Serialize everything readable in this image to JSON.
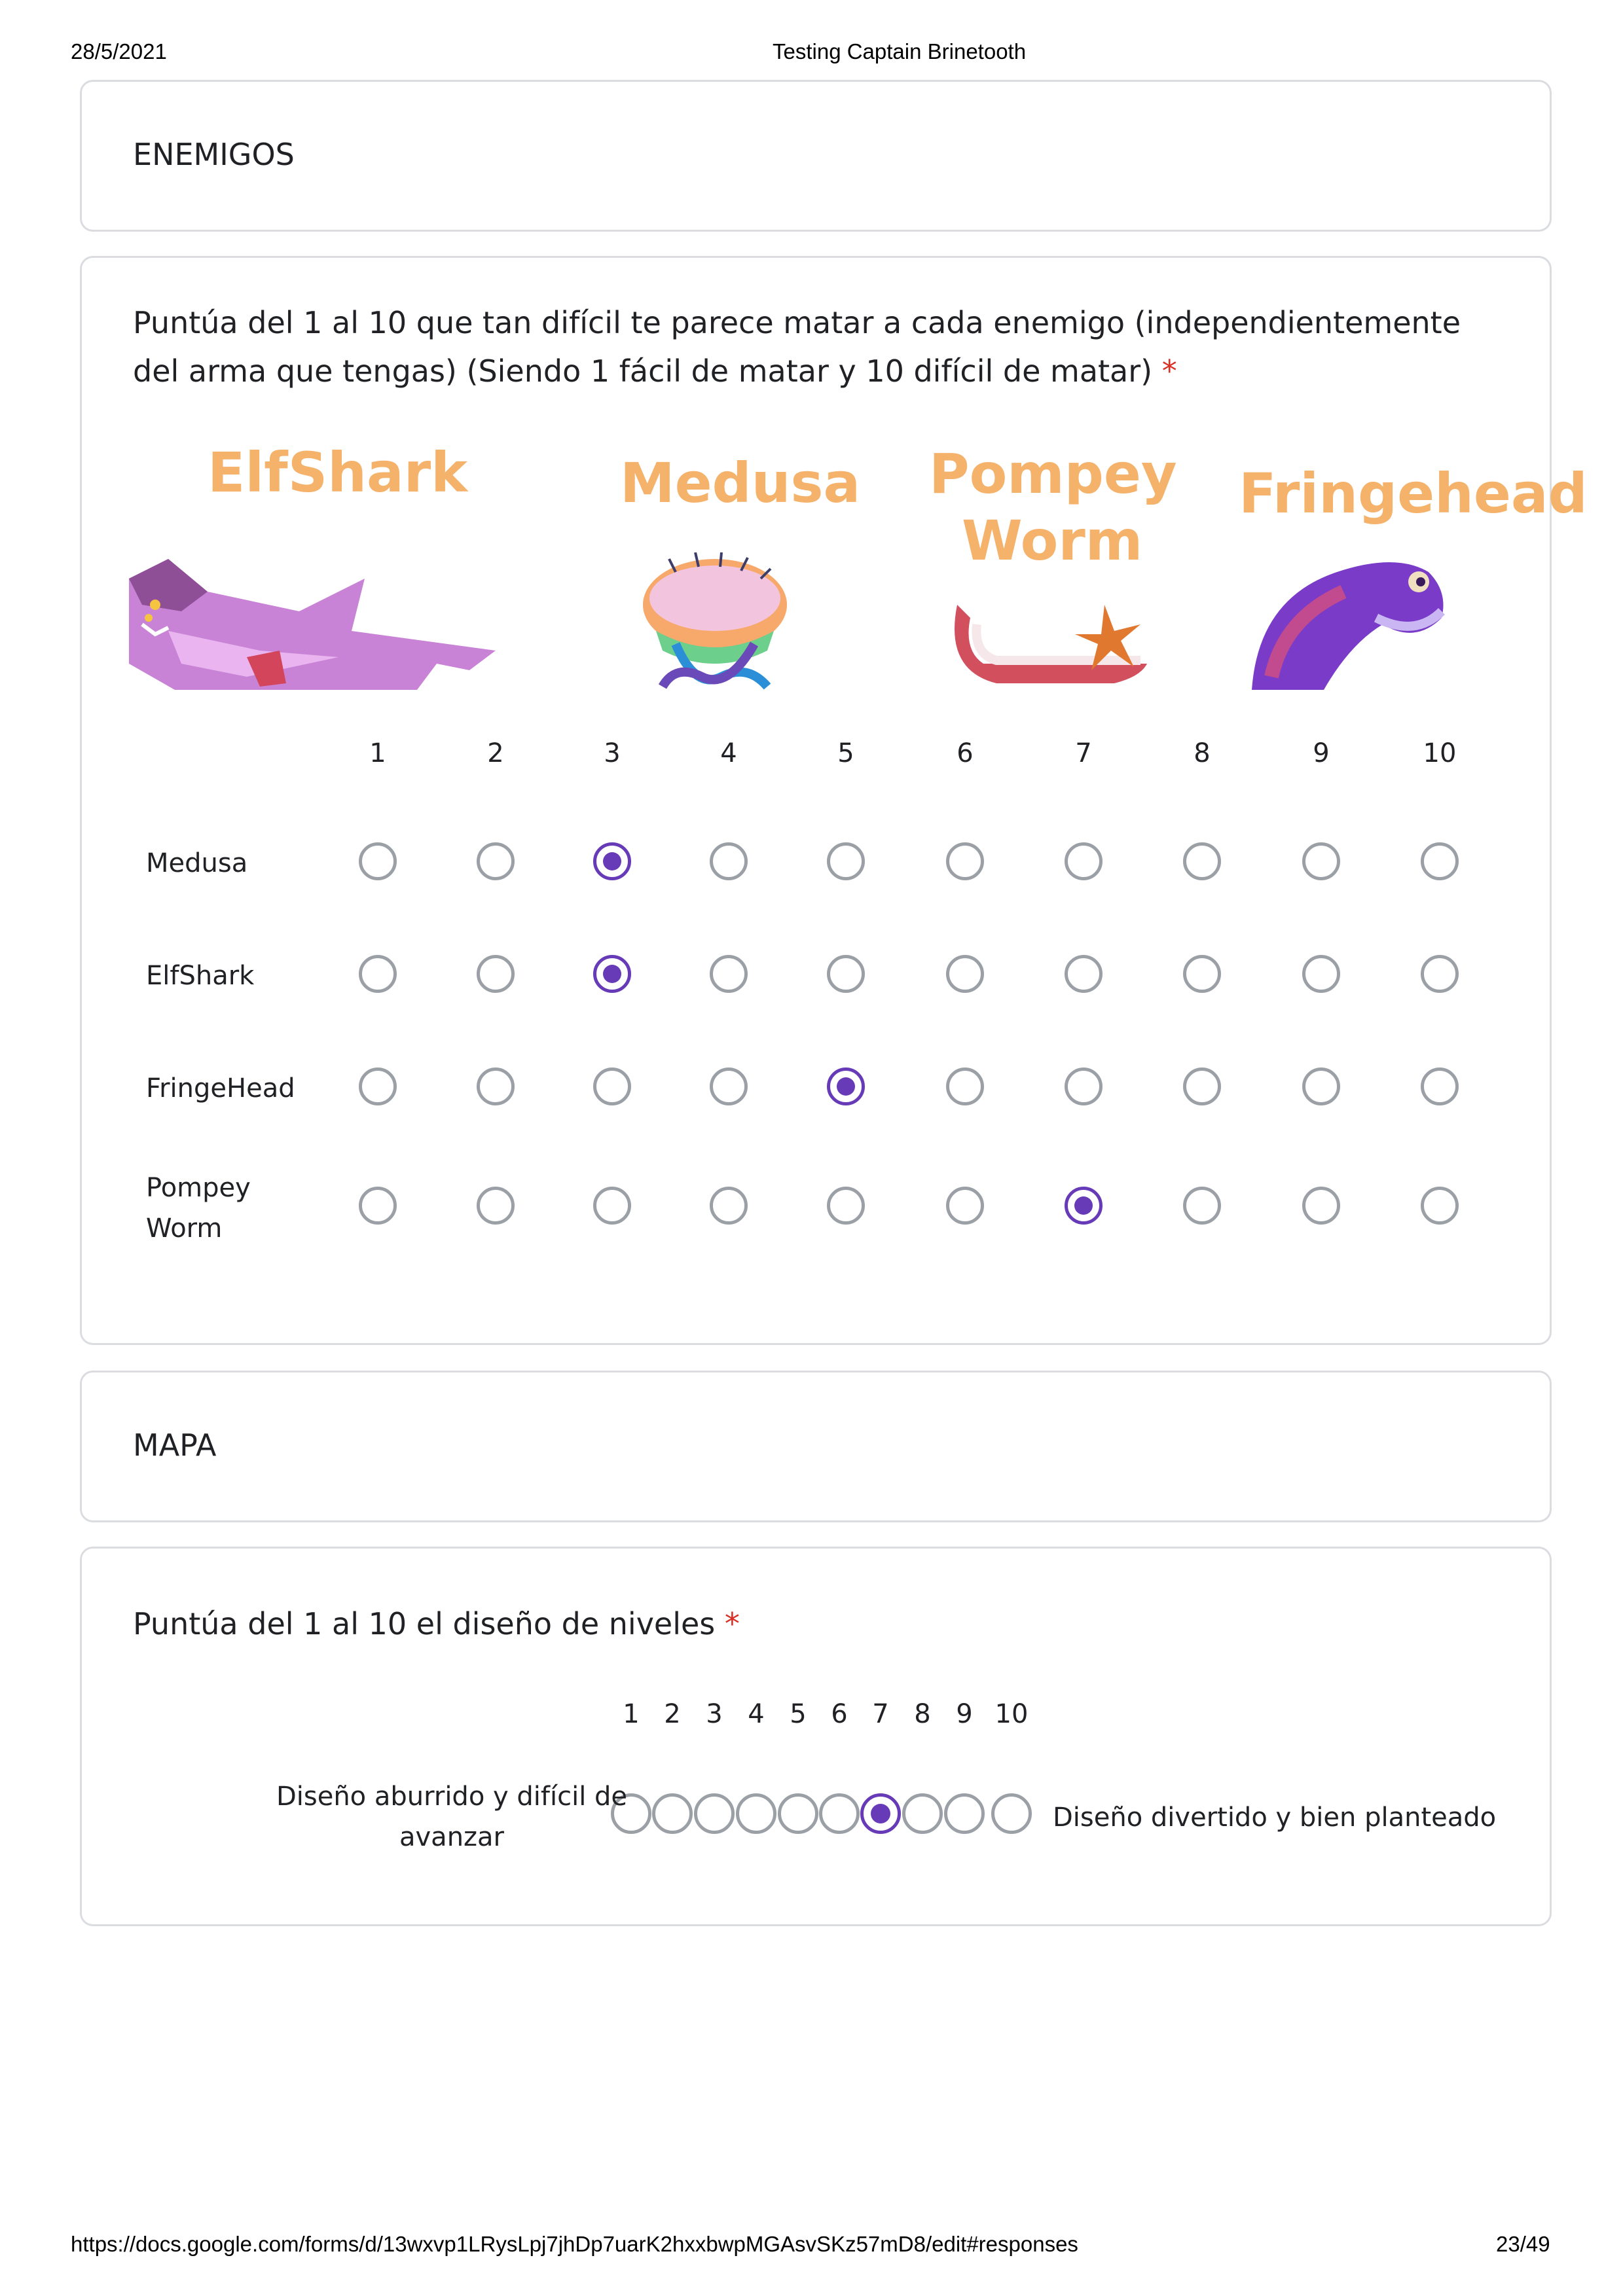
{
  "print_header": {
    "date": "28/5/2021",
    "title": "Testing Captain Brinetooth"
  },
  "print_footer": {
    "url": "https://docs.google.com/forms/d/13wxvp1LRysLpj7jhDp7uarK2hxxbwpMGAsvSKz57mD8/edit#responses",
    "page": "23/49"
  },
  "section_enemies": {
    "title": "ENEMIGOS"
  },
  "question_enemies": {
    "text": "Puntúa del 1 al 10 que tan difícil te parece matar a cada enemigo (independientemente del arma que tengas) (Siendo 1 fácil de matar y 10 difícil de matar)",
    "required_mark": "*",
    "image_names": [
      "ElfShark",
      "Medusa",
      "Pompey",
      "Worm",
      "Fringehead"
    ],
    "image_colors": {
      "name_orange": "#f4b26b"
    },
    "columns": [
      "1",
      "2",
      "3",
      "4",
      "5",
      "6",
      "7",
      "8",
      "9",
      "10"
    ],
    "rows": [
      {
        "label": "Medusa",
        "selected": 3
      },
      {
        "label": "ElfShark",
        "selected": 3
      },
      {
        "label": "FringeHead",
        "selected": 5
      },
      {
        "label_line1": "Pompey",
        "label_line2": "Worm",
        "selected": 7
      }
    ]
  },
  "section_map": {
    "title": "MAPA"
  },
  "question_levels": {
    "text": "Puntúa del 1 al 10 el diseño de niveles",
    "required_mark": "*",
    "scale": [
      "1",
      "2",
      "3",
      "4",
      "5",
      "6",
      "7",
      "8",
      "9",
      "10"
    ],
    "selected": 7,
    "low_label_line1": "Diseño aburrido y difícil de",
    "low_label_line2": "avanzar",
    "high_label": "Diseño divertido y bien planteado"
  },
  "colors": {
    "accent": "#673ab7",
    "required": "#d93025",
    "radio_border": "#9aa0a6",
    "card_border": "#dadce0"
  }
}
